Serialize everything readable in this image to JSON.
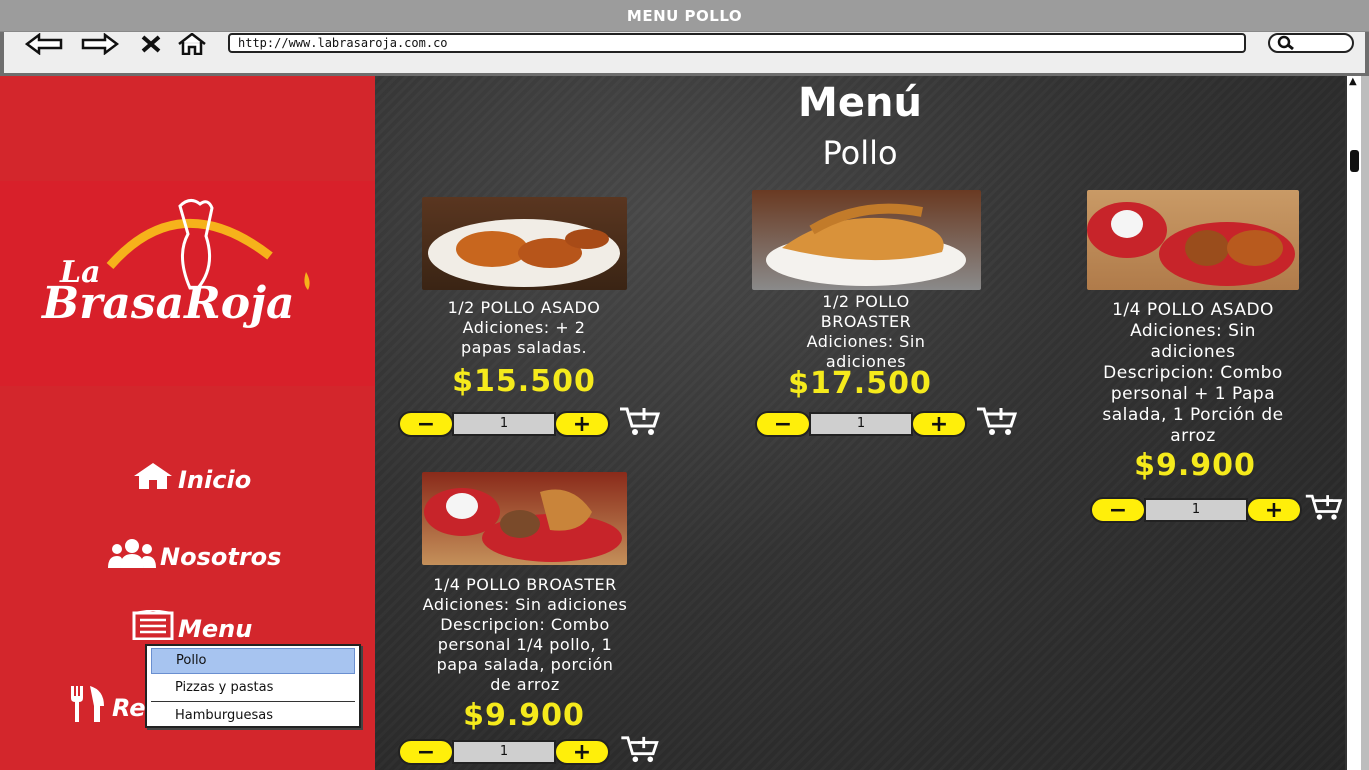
{
  "window": {
    "title": "MENU POLLO"
  },
  "browser": {
    "url": "http://www.labrasaroja.com.co"
  },
  "brand": {
    "line1": "La",
    "line2": "BrasaRoja"
  },
  "sidebar": {
    "items": [
      {
        "label": "Inicio"
      },
      {
        "label": "Nosotros"
      },
      {
        "label": "Menu"
      },
      {
        "label": "Re"
      }
    ],
    "submenu": [
      "Pollo",
      "Pizzas y pastas",
      "Hamburguesas"
    ]
  },
  "page": {
    "title": "Menú",
    "subtitle": "Pollo"
  },
  "products": [
    {
      "name": "1/2 POLLO ASADO\nAdiciones: + 2\npapas saladas.",
      "price": "$15.500",
      "qty": "1"
    },
    {
      "name": "1/2 POLLO\nBROASTER\nAdiciones: Sin\nadiciones",
      "price": "$17.500",
      "qty": "1"
    },
    {
      "name": "1/4 POLLO ASADO\nAdiciones: Sin\nadiciones\nDescripcion: Combo\npersonal + 1 Papa\nsalada, 1 Porción de\narroz",
      "price": "$9.900",
      "qty": "1"
    },
    {
      "name": "1/4 POLLO BROASTER\nAdiciones: Sin adiciones\nDescripcion: Combo\npersonal 1/4 pollo, 1\npapa salada, porción\nde arroz",
      "price": "$9.900",
      "qty": "1"
    }
  ],
  "stepper": {
    "minus": "−",
    "plus": "+"
  },
  "colors": {
    "sidebar": "#d3262c",
    "price": "#f5ea1c",
    "button": "#ffef0a",
    "selected": "#a7c4f0"
  }
}
